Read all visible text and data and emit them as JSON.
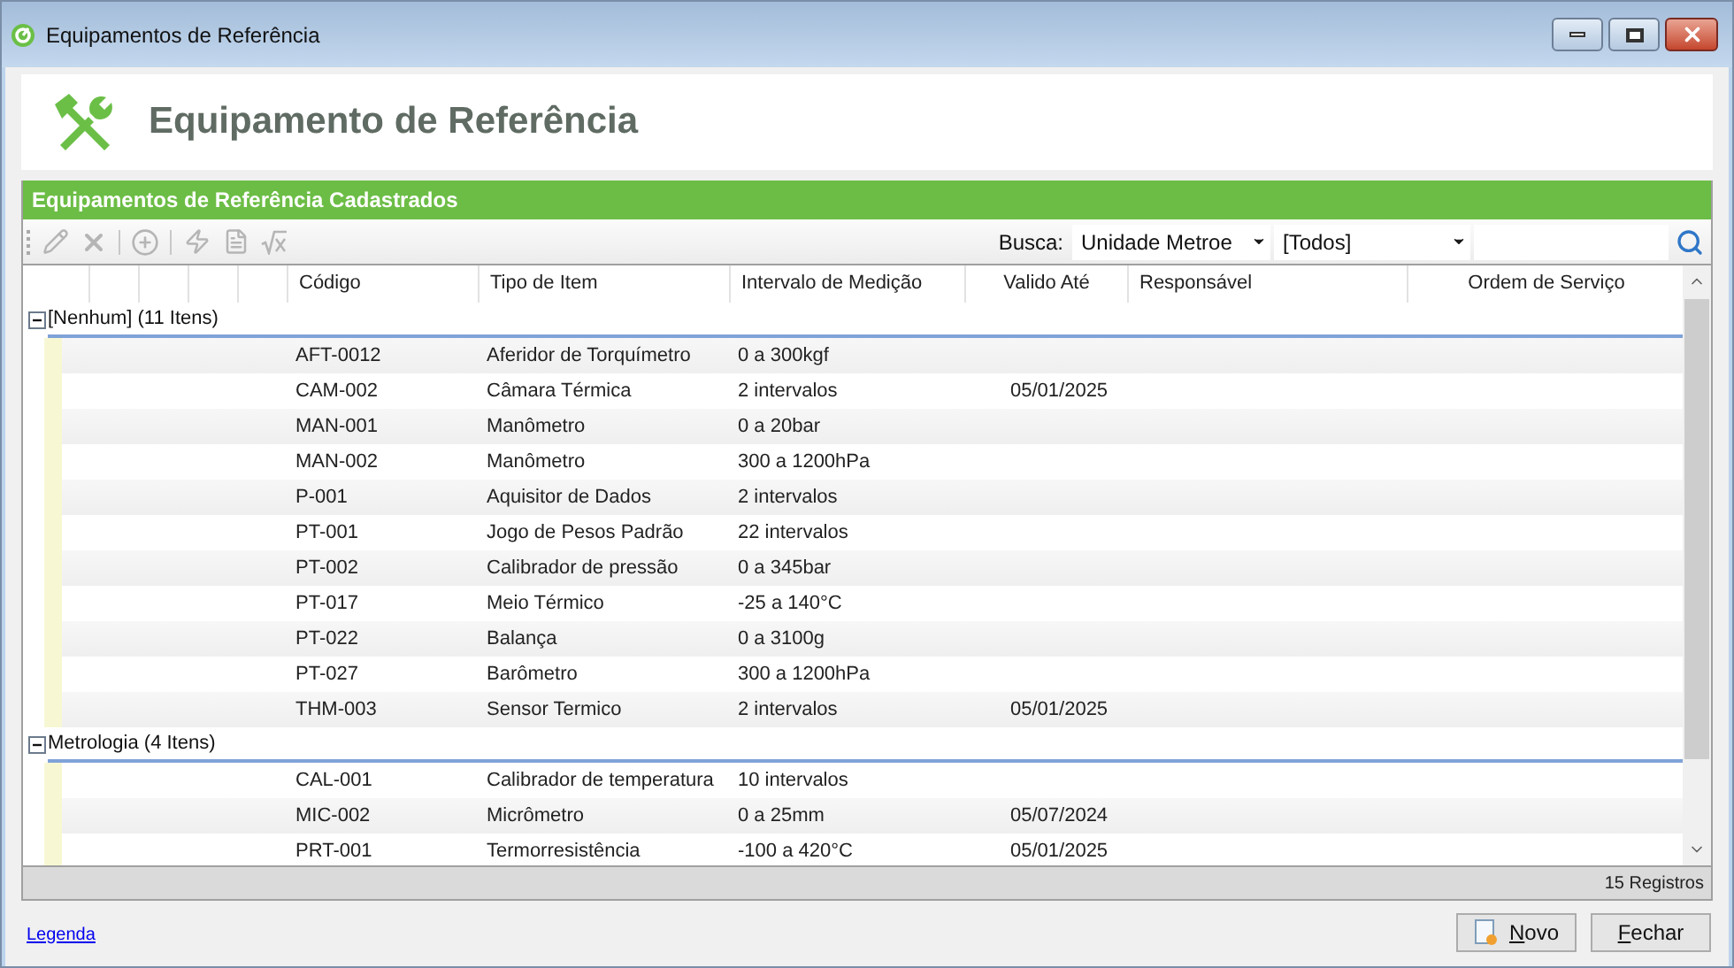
{
  "window": {
    "title": "Equipamentos de Referência"
  },
  "header": {
    "title": "Equipamento de Referência"
  },
  "panel": {
    "title": "Equipamentos de Referência Cadastrados"
  },
  "toolbar": [
    {
      "kind": "edit",
      "disabled": true
    },
    {
      "kind": "delete",
      "disabled": true
    },
    {
      "kind": "add",
      "disabled": true
    },
    {
      "kind": "lightning",
      "disabled": true
    },
    {
      "kind": "document",
      "disabled": true
    },
    {
      "kind": "formula",
      "disabled": true
    }
  ],
  "search": {
    "label": "Busca:",
    "field": "Unidade Metroe",
    "filter": "[Todos]"
  },
  "table": {
    "columns": [
      "Código",
      "Tipo de Item",
      "Intervalo de Medição",
      "Valido Até",
      "Responsável",
      "Ordem de Serviço"
    ],
    "groups": [
      {
        "label": "[Nenhum] (11 Itens)",
        "expanded": true,
        "rows": [
          {
            "codigo": "AFT-0012",
            "tipo": "Aferidor de Torquímetro",
            "intervalo": "0 a 300kgf",
            "valido": ""
          },
          {
            "codigo": "CAM-002",
            "tipo": "Câmara Térmica",
            "intervalo": "2 intervalos",
            "valido": "05/01/2025"
          },
          {
            "codigo": "MAN-001",
            "tipo": "Manômetro",
            "intervalo": "0 a 20bar",
            "valido": ""
          },
          {
            "codigo": "MAN-002",
            "tipo": "Manômetro",
            "intervalo": "300 a 1200hPa",
            "valido": ""
          },
          {
            "codigo": "P-001",
            "tipo": "Aquisitor de Dados",
            "intervalo": "2 intervalos",
            "valido": ""
          },
          {
            "codigo": "PT-001",
            "tipo": "Jogo de Pesos Padrão",
            "intervalo": "22 intervalos",
            "valido": ""
          },
          {
            "codigo": "PT-002",
            "tipo": "Calibrador de pressão",
            "intervalo": "0 a 345bar",
            "valido": ""
          },
          {
            "codigo": "PT-017",
            "tipo": "Meio Térmico",
            "intervalo": "-25 a 140°C",
            "valido": ""
          },
          {
            "codigo": "PT-022",
            "tipo": "Balança",
            "intervalo": "0 a 3100g",
            "valido": ""
          },
          {
            "codigo": "PT-027",
            "tipo": "Barômetro",
            "intervalo": "300 a 1200hPa",
            "valido": ""
          },
          {
            "codigo": "THM-003",
            "tipo": "Sensor Termico",
            "intervalo": "2 intervalos",
            "valido": "05/01/2025"
          }
        ]
      },
      {
        "label": "Metrologia (4 Itens)",
        "expanded": true,
        "rows": [
          {
            "codigo": "CAL-001",
            "tipo": "Calibrador de temperatura",
            "intervalo": "10 intervalos",
            "valido": ""
          },
          {
            "codigo": "MIC-002",
            "tipo": "Micrômetro",
            "intervalo": "0 a 25mm",
            "valido": "05/07/2024"
          },
          {
            "codigo": "PRT-001",
            "tipo": "Termorresistência",
            "intervalo": "-100 a 420°C",
            "valido": "05/01/2025"
          }
        ]
      }
    ]
  },
  "status": "15 Registros",
  "legend_link": "Legenda",
  "buttons": [
    {
      "kind": "new",
      "label": "Novo"
    },
    {
      "kind": "close",
      "label": "Fechar"
    }
  ]
}
